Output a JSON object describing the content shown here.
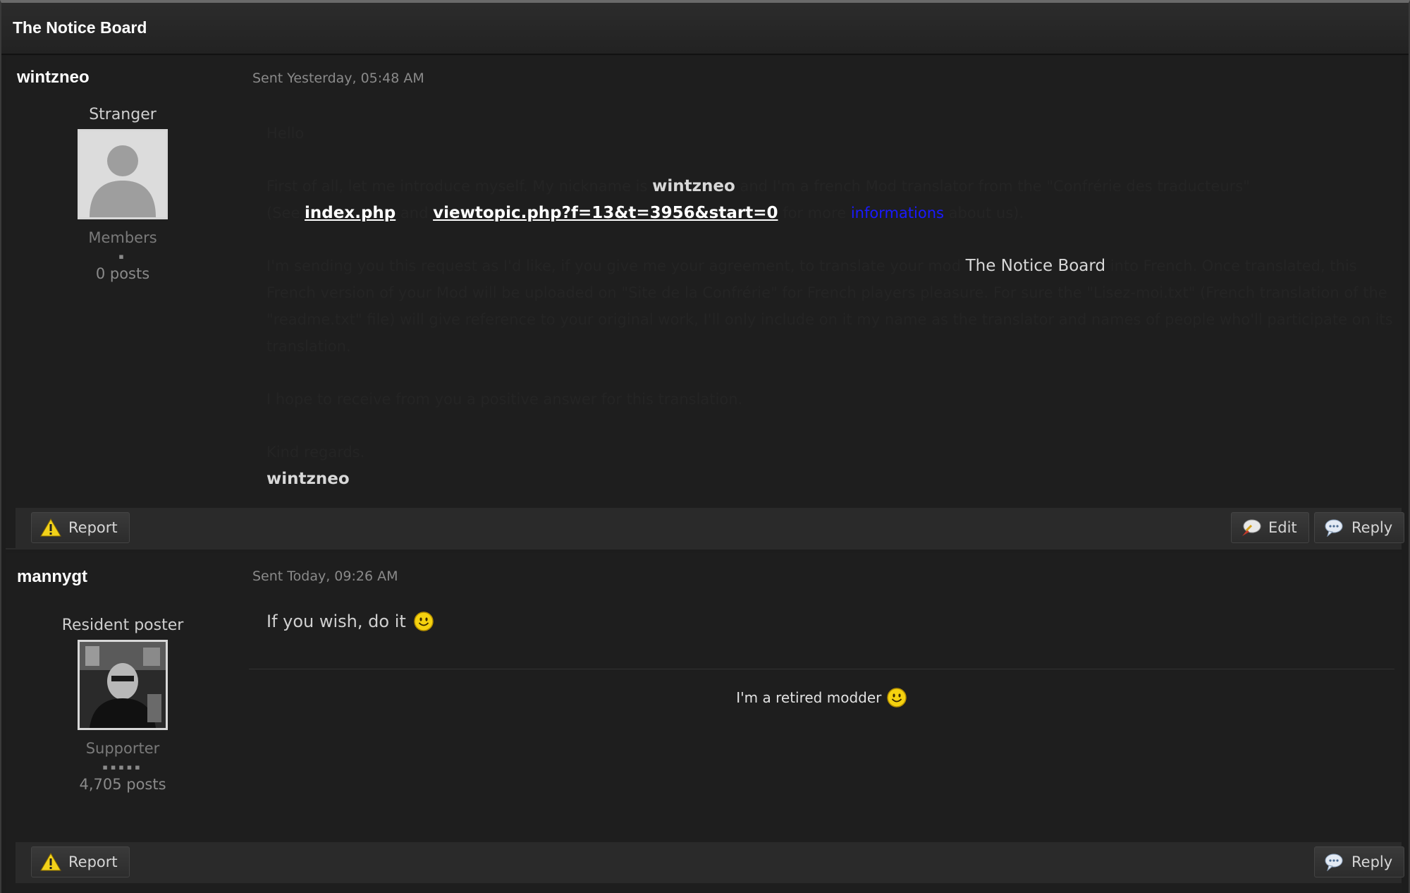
{
  "board": {
    "title": "The Notice Board"
  },
  "posts": [
    {
      "username": "wintzneo",
      "rank_title": "Stranger",
      "group": "Members",
      "pips": "▪",
      "post_count": "0 posts",
      "sent": "Sent Yesterday, 05:48 AM",
      "body": {
        "greeting": "Hello",
        "p1_a": "First of all, let me introduce myself. My nickname is ",
        "p1_name": "wintzneo",
        "p1_b": " and I'm a french Mod translator from the \"Confrérie des traducteurs\"",
        "p1_c": "(See ",
        "p1_link1": "index.php",
        "p1_d": " and ",
        "p1_link2": "viewtopic.php?f=13&t=3956&start=0",
        "p1_e": " for more ",
        "p1_link3": "informations",
        "p1_f": " about us).",
        "p2_a": "I'm sending you this request as I'd like, if you give me your agreement, to translate your mod ",
        "p2_mod": "The Notice Board",
        "p2_b": " into French. Once translated, this French version of your Mod will be uploaded on \"Site de la Confrérie\" for French players pleasure. For sure the \"Lisez-moi.txt\" (French translation of the \"readme.txt\" file) will give reference to your original work, I'll only include on it my name as the translator and names of people who'll participate on its translation.",
        "p3": "I hope to receive from you a positive answer for this translation.",
        "closing": "Kind regards.",
        "signoff": "wintzneo"
      },
      "actions": {
        "report": "Report",
        "edit": "Edit",
        "reply": "Reply"
      }
    },
    {
      "username": "mannygt",
      "rank_title": "Resident poster",
      "group": "Supporter",
      "pips": "▪▪▪▪▪",
      "post_count": "4,705 posts",
      "sent": "Sent Today, 09:26 AM",
      "body": {
        "text": "If you wish, do it"
      },
      "signature": "I'm a retired modder",
      "actions": {
        "report": "Report",
        "reply": "Reply"
      }
    }
  ],
  "colors": {
    "link_blue": "#1a1aff",
    "warning_yellow": "#f2d21a",
    "smiley_yellow": "#f5d20f"
  }
}
